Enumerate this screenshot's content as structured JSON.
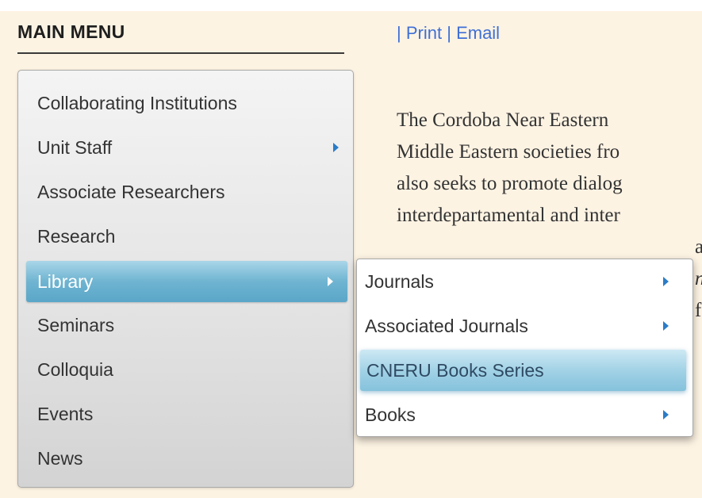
{
  "sidebar": {
    "heading": "MAIN MENU",
    "items": [
      {
        "label": "Collaborating Institutions",
        "has_submenu": false
      },
      {
        "label": "Unit Staff",
        "has_submenu": true
      },
      {
        "label": "Associate Researchers",
        "has_submenu": false
      },
      {
        "label": "Research",
        "has_submenu": false
      },
      {
        "label": "Library",
        "has_submenu": true,
        "active": true
      },
      {
        "label": "Seminars",
        "has_submenu": false
      },
      {
        "label": "Colloquia",
        "has_submenu": false
      },
      {
        "label": "Events",
        "has_submenu": false
      },
      {
        "label": "News",
        "has_submenu": false
      }
    ]
  },
  "submenu": {
    "items": [
      {
        "label": "Journals",
        "has_submenu": true
      },
      {
        "label": "Associated Journals",
        "has_submenu": true
      },
      {
        "label": "CNERU Books Series",
        "has_submenu": false,
        "active": true
      },
      {
        "label": "Books",
        "has_submenu": true
      }
    ]
  },
  "toolbar": {
    "sep1": "|",
    "print_label": "Print",
    "sep2": "|",
    "email_label": "Email"
  },
  "article": {
    "lines": [
      "The Cordoba Near Eastern",
      "Middle Eastern societies fro",
      "also seeks to promote dialog",
      "interdepartamental and inter",
      "a",
      "n",
      "f"
    ]
  },
  "colors": {
    "page_background": "#fdf3e3",
    "link": "#3f6fd6",
    "active_item": "#6fb4d1",
    "submenu_active": "#a2d2e6",
    "arrow": "#2b7cc7"
  },
  "icons": {
    "submenu_arrow": "triangle-right"
  }
}
